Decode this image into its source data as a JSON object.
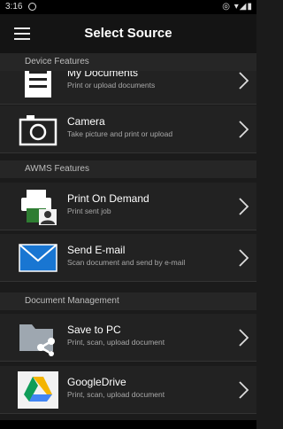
{
  "status": {
    "time": "3:16",
    "icons": "◎ ▾◢▮"
  },
  "appbar": {
    "title": "Select Source"
  },
  "sections": {
    "device": "Device Features",
    "awms": "AWMS Features",
    "docmgmt": "Document Management"
  },
  "items": {
    "mydocs": {
      "label": "My Documents",
      "sub": "Print or upload documents"
    },
    "camera": {
      "label": "Camera",
      "sub": "Take picture and print or upload"
    },
    "pod": {
      "label": "Print On Demand",
      "sub": "Print sent job"
    },
    "email": {
      "label": "Send E-mail",
      "sub": "Scan document and send by e-mail"
    },
    "savepc": {
      "label": "Save to PC",
      "sub": "Print, scan, upload document"
    },
    "gdrive": {
      "label": "GoogleDrive",
      "sub": "Print, scan, upload document"
    }
  },
  "colors": {
    "background": "#1b1b1b",
    "row": "#222222",
    "header": "#262626",
    "email_blue": "#1976d2"
  }
}
